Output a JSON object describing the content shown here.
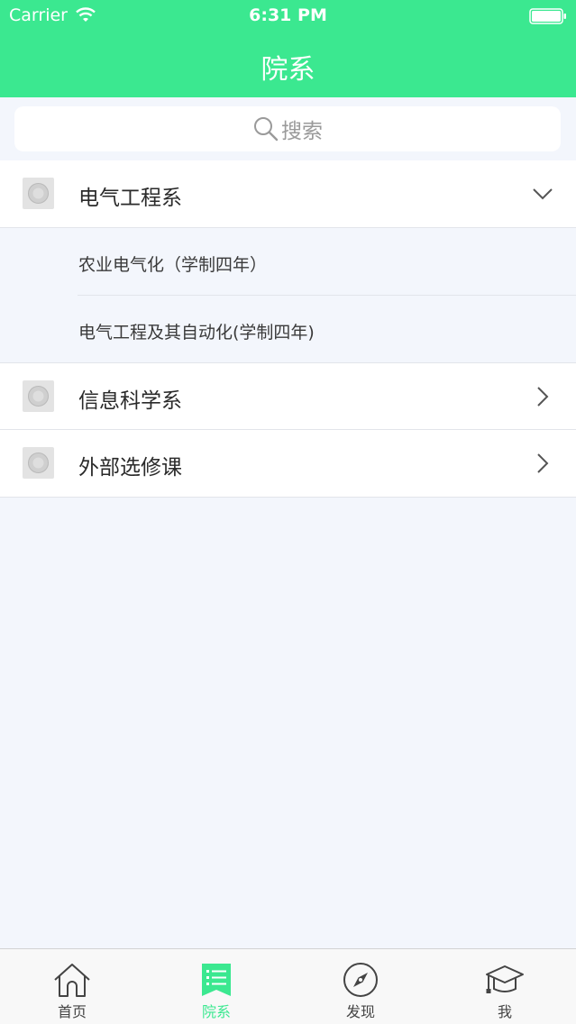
{
  "status_bar": {
    "carrier": "Carrier",
    "time": "6:31 PM"
  },
  "nav": {
    "title": "院系"
  },
  "search": {
    "placeholder": "搜索"
  },
  "departments": [
    {
      "label": "电气工程系",
      "expanded": true,
      "majors": [
        {
          "label": "农业电气化（学制四年）"
        },
        {
          "label": "电气工程及其自动化(学制四年)"
        }
      ]
    },
    {
      "label": "信息科学系",
      "expanded": false
    },
    {
      "label": "外部选修课",
      "expanded": false
    }
  ],
  "tab_bar": {
    "items": [
      {
        "label": "首页",
        "icon": "home-icon",
        "active": false
      },
      {
        "label": "院系",
        "icon": "list-icon",
        "active": true
      },
      {
        "label": "发现",
        "icon": "compass-icon",
        "active": false
      },
      {
        "label": "我",
        "icon": "graduation-cap-icon",
        "active": false
      }
    ]
  },
  "colors": {
    "accent": "#3be890",
    "background": "#f3f6fc",
    "text": "#2a2a2a",
    "muted": "#9a9a9a"
  }
}
